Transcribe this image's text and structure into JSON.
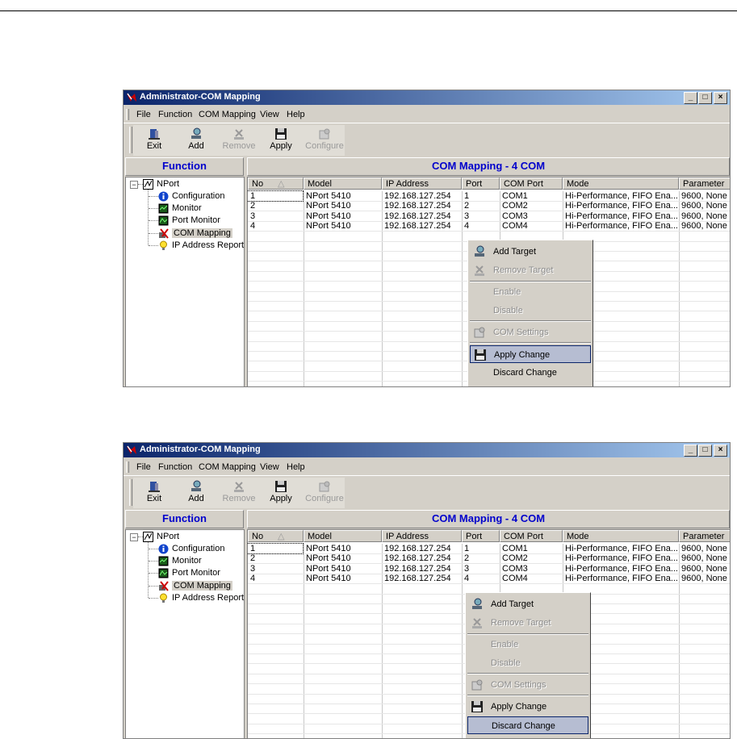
{
  "window": {
    "title": "Administrator-COM Mapping",
    "buttons": [
      "_",
      "□",
      "×"
    ]
  },
  "menu": [
    "File",
    "Function",
    "COM Mapping",
    "View",
    "Help"
  ],
  "toolbar": [
    {
      "label": "Exit",
      "icon": "exit-icon",
      "enabled": true
    },
    {
      "label": "Add",
      "icon": "add-icon",
      "enabled": true
    },
    {
      "label": "Remove",
      "icon": "remove-icon",
      "enabled": false
    },
    {
      "label": "Apply",
      "icon": "apply-icon",
      "enabled": true
    },
    {
      "label": "Configure",
      "icon": "configure-icon",
      "enabled": false
    }
  ],
  "left_pane": {
    "header": "Function",
    "tree_root": "NPort",
    "tree_toggle": "−",
    "tree_items": [
      "Configuration",
      "Monitor",
      "Port Monitor",
      "COM Mapping",
      "IP Address Report"
    ],
    "selected": "COM Mapping"
  },
  "right_pane": {
    "header": "COM Mapping - 4 COM",
    "columns": [
      "No",
      "Model",
      "IP Address",
      "Port",
      "COM Port",
      "Mode",
      "Parameter"
    ],
    "sort_indicator": "△",
    "rows": [
      [
        "1",
        "NPort 5410",
        "192.168.127.254",
        "1",
        "COM1",
        "Hi-Performance, FIFO Ena...",
        "9600, None"
      ],
      [
        "2",
        "NPort 5410",
        "192.168.127.254",
        "2",
        "COM2",
        "Hi-Performance, FIFO Ena...",
        "9600, None"
      ],
      [
        "3",
        "NPort 5410",
        "192.168.127.254",
        "3",
        "COM3",
        "Hi-Performance, FIFO Ena...",
        "9600, None"
      ],
      [
        "4",
        "NPort 5410",
        "192.168.127.254",
        "4",
        "COM4",
        "Hi-Performance, FIFO Ena...",
        "9600, None"
      ]
    ]
  },
  "context_menu": {
    "items": [
      {
        "label": "Add Target",
        "enabled": true,
        "icon": "add-target-icon"
      },
      {
        "label": "Remove Target",
        "enabled": false,
        "icon": "remove-target-icon"
      },
      {
        "label": "Enable",
        "enabled": false
      },
      {
        "label": "Disable",
        "enabled": false
      },
      {
        "label": "COM Settings",
        "enabled": false,
        "icon": "com-settings-icon"
      },
      {
        "label": "Apply Change",
        "enabled": true,
        "icon": "apply-change-icon"
      },
      {
        "label": "Discard Change",
        "enabled": true
      }
    ]
  },
  "screenshots": [
    {
      "highlighted_menu_item": "Apply Change"
    },
    {
      "highlighted_menu_item": "Discard Change"
    }
  ],
  "colors": {
    "title_gradient_start": "#0a246a",
    "title_gradient_end": "#a6caf0",
    "pane_header_text": "#0000cc",
    "menu_highlight": "#b6bdd2"
  }
}
